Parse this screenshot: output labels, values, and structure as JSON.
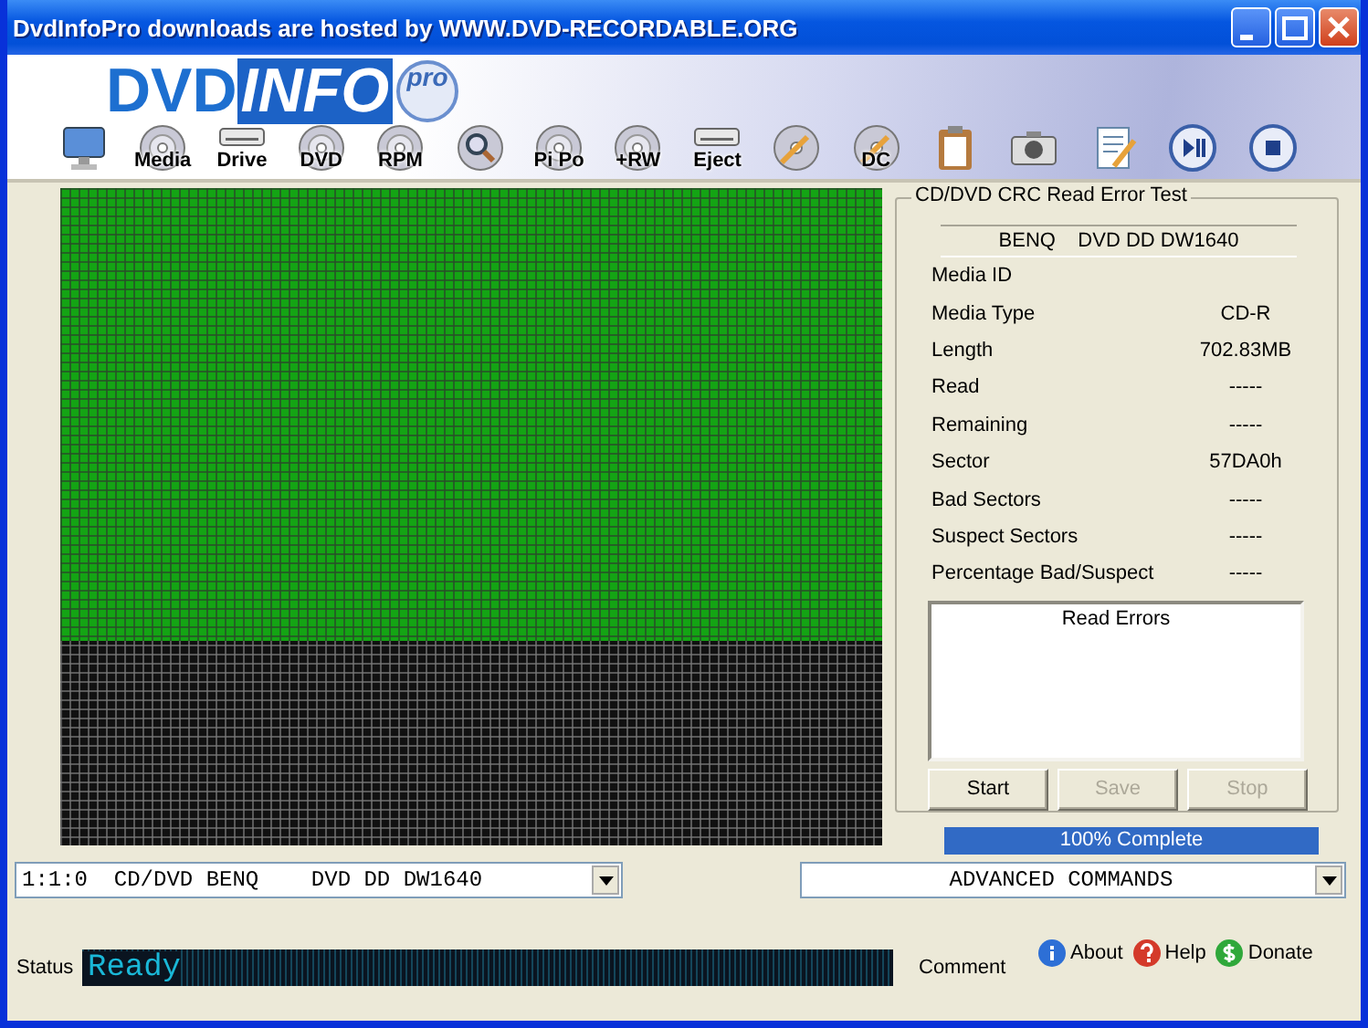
{
  "window": {
    "title": "DvdInfoPro downloads are hosted by WWW.DVD-RECORDABLE.ORG"
  },
  "logo": {
    "part_1": "DVD",
    "part_2": "INFO",
    "part_3": "pro"
  },
  "toolbar": [
    {
      "kind": "monitor"
    },
    {
      "kind": "disc",
      "label": "Media"
    },
    {
      "kind": "drive",
      "label": "Drive"
    },
    {
      "kind": "disc",
      "label": "DVD"
    },
    {
      "kind": "disc",
      "label": "RPM"
    },
    {
      "kind": "magnifier"
    },
    {
      "kind": "disc",
      "label": "Pi Po"
    },
    {
      "kind": "disc",
      "label": "+RW"
    },
    {
      "kind": "drive",
      "label": "Eject"
    },
    {
      "kind": "disc-pencil"
    },
    {
      "kind": "disc-pencil",
      "label": "DC"
    },
    {
      "kind": "clipboard"
    },
    {
      "kind": "camera"
    },
    {
      "kind": "notepad"
    },
    {
      "kind": "play-pause"
    },
    {
      "kind": "stop"
    }
  ],
  "test_panel": {
    "title": "CD/DVD CRC Read Error Test",
    "drive": "BENQ    DVD DD DW1640",
    "fields": [
      {
        "label": "Media ID"
      },
      {
        "label": "Media Type",
        "value": "CD-R"
      },
      {
        "label": "Length",
        "value": "702.83MB"
      },
      {
        "label": "Read",
        "value": "-----"
      },
      {
        "label": "Remaining",
        "value": "-----"
      },
      {
        "label": "Sector",
        "value": "57DA0h"
      },
      {
        "label": "Bad Sectors",
        "value": "-----"
      },
      {
        "label": "Suspect Sectors",
        "value": "-----"
      },
      {
        "label": "Percentage Bad/Suspect",
        "value": "-----"
      }
    ],
    "read_errors_title": "Read Errors",
    "buttons": [
      {
        "label": "Start",
        "disabled": false
      },
      {
        "label": "Save",
        "disabled": true
      },
      {
        "label": "Stop",
        "disabled": true
      }
    ]
  },
  "progress": {
    "level": 1.0,
    "text": "100% Complete"
  },
  "drive_select": {
    "value": "1:1:0  CD/DVD BENQ    DVD DD DW1640"
  },
  "commands_select": {
    "value": "ADVANCED COMMANDS"
  },
  "status_bar": {
    "label": "Status",
    "display": "Ready",
    "comment": "Comment",
    "links": [
      {
        "kind": "info",
        "label": "About"
      },
      {
        "kind": "help",
        "label": "Help"
      },
      {
        "kind": "donate",
        "label": "Donate"
      }
    ]
  }
}
